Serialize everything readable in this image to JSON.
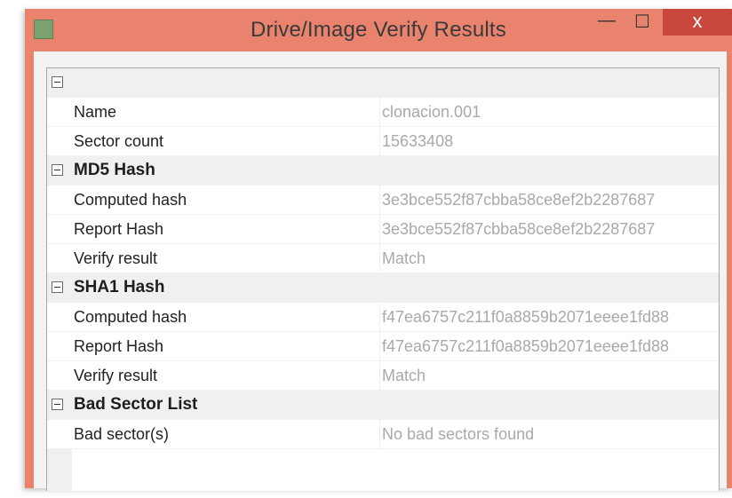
{
  "window": {
    "title": "Drive/Image Verify Results",
    "controls": {
      "minimize": "—",
      "maximize": "☐",
      "close": "x"
    },
    "colors": {
      "frame": "#e9836d",
      "close": "#c9473d"
    }
  },
  "grid": {
    "rows": [
      {
        "kind": "category",
        "label": ""
      },
      {
        "kind": "prop",
        "name": "Name",
        "value": "clonacion.001"
      },
      {
        "kind": "prop",
        "name": "Sector count",
        "value": "15633408"
      },
      {
        "kind": "category",
        "label": "MD5 Hash"
      },
      {
        "kind": "prop",
        "name": "Computed hash",
        "value": "3e3bce552f87cbba58ce8ef2b2287687"
      },
      {
        "kind": "prop",
        "name": "Report Hash",
        "value": "3e3bce552f87cbba58ce8ef2b2287687"
      },
      {
        "kind": "prop",
        "name": "Verify result",
        "value": "Match"
      },
      {
        "kind": "category",
        "label": "SHA1 Hash"
      },
      {
        "kind": "prop",
        "name": "Computed hash",
        "value": "f47ea6757c211f0a8859b2071eeee1fd88"
      },
      {
        "kind": "prop",
        "name": "Report Hash",
        "value": "f47ea6757c211f0a8859b2071eeee1fd88"
      },
      {
        "kind": "prop",
        "name": "Verify result",
        "value": "Match"
      },
      {
        "kind": "category",
        "label": "Bad Sector List"
      },
      {
        "kind": "prop",
        "name": "Bad sector(s)",
        "value": "No bad sectors found"
      }
    ]
  }
}
